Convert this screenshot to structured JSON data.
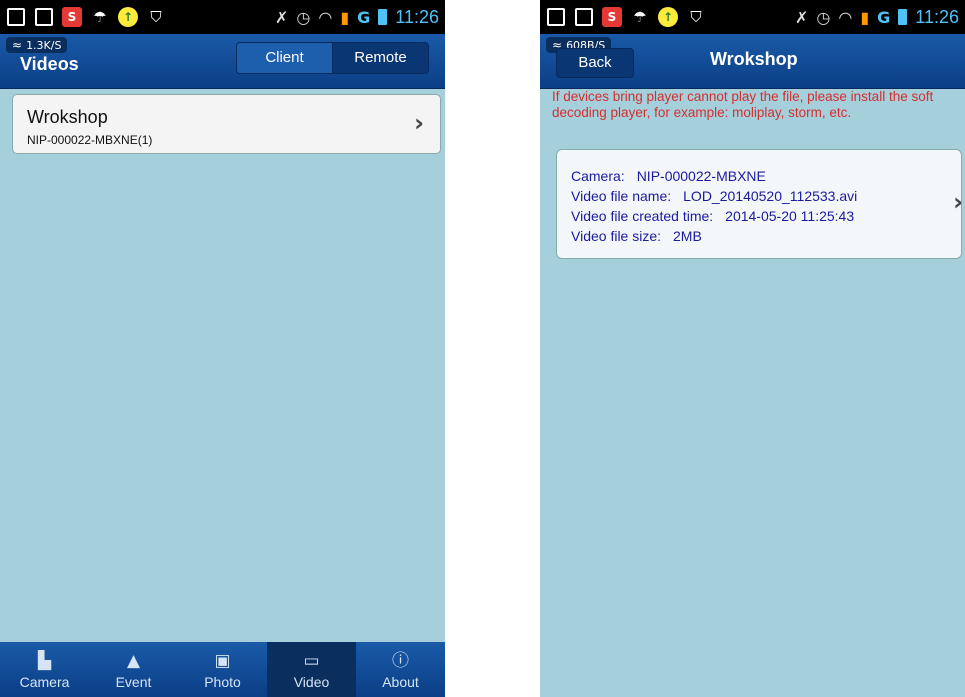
{
  "left": {
    "status": {
      "speed": "1.3K/S",
      "time": "11:26"
    },
    "header": {
      "title": "Videos",
      "segment": [
        "Client",
        "Remote"
      ]
    },
    "list": [
      {
        "title": "Wrokshop",
        "subtitle": "NIP-000022-MBXNE(1)"
      }
    ],
    "tabs": [
      {
        "label": "Camera",
        "icon": "camera-icon"
      },
      {
        "label": "Event",
        "icon": "bell-icon"
      },
      {
        "label": "Photo",
        "icon": "photo-icon"
      },
      {
        "label": "Video",
        "icon": "film-icon"
      },
      {
        "label": "About",
        "icon": "info-icon"
      }
    ],
    "active_tab": "Video"
  },
  "right": {
    "status": {
      "speed": "608B/S",
      "time": "11:26"
    },
    "header": {
      "back": "Back",
      "title": "Wrokshop"
    },
    "notice": "If devices bring player cannot play the file, please install the soft decoding player, for example: moliplay, storm, etc.",
    "info": {
      "camera_label": "Camera:",
      "camera_value": "NIP-000022-MBXNE",
      "name_label": "Video file name:",
      "name_value": "LOD_20140520_112533.avi",
      "created_label": "Video file created time:",
      "created_value": "2014-05-20  11:25:43",
      "size_label": "Video file size:",
      "size_value": "2MB"
    }
  },
  "colors": {
    "screen_bg": "#a6cfdc",
    "header_blue": "#0b3f86",
    "notice_red": "#d32f2f",
    "info_blue": "#1a1aa0"
  }
}
